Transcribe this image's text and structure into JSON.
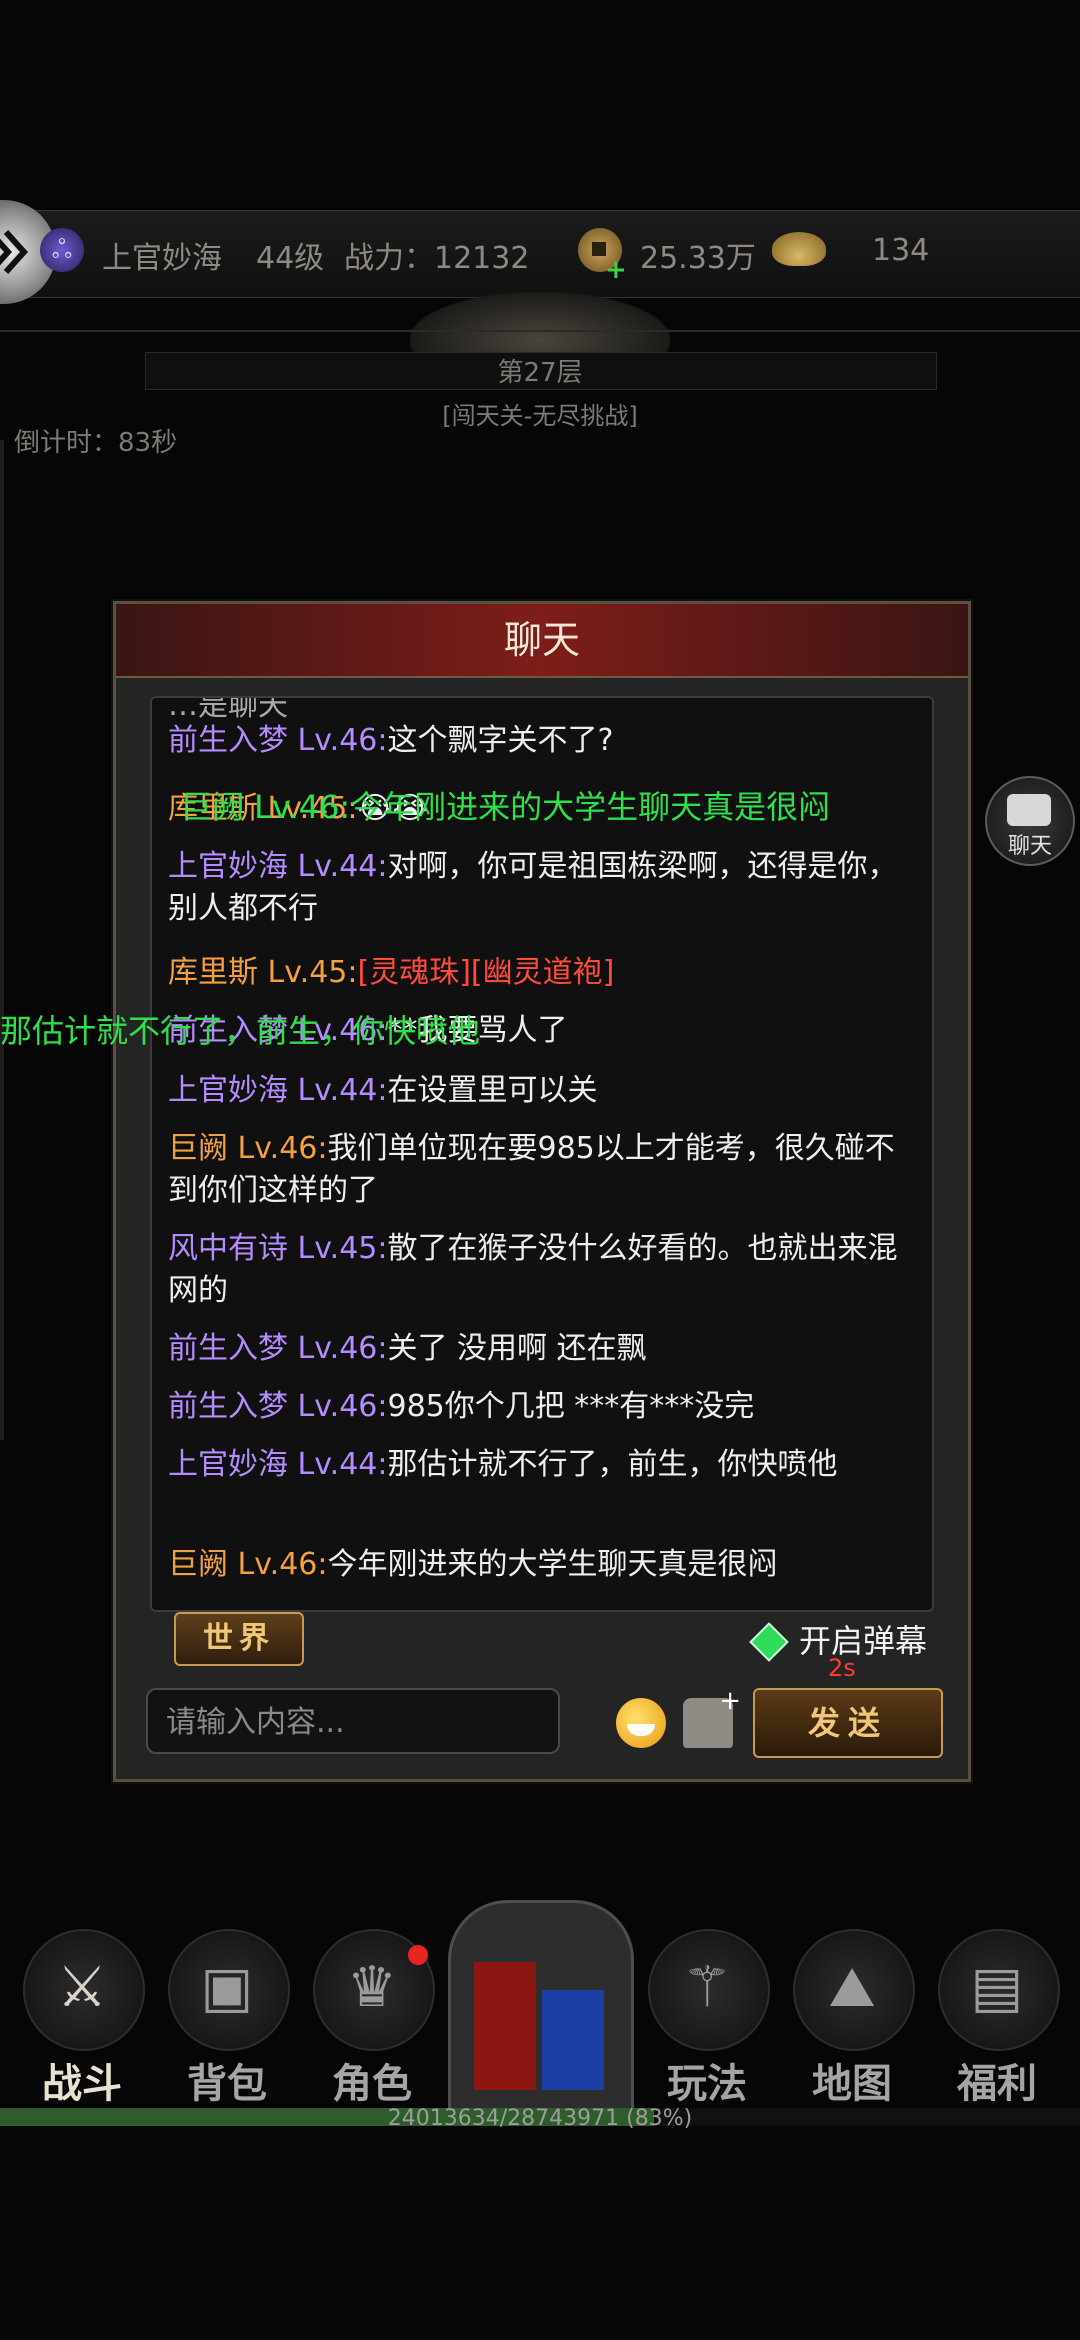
{
  "header": {
    "player_name": "上官妙海",
    "level": "44级",
    "power": "战力：12132",
    "coins": "25.33万",
    "gold": "134"
  },
  "stage": {
    "floor": "第27层",
    "subtitle": "[闯天关-无尽挑战]",
    "countdown": "倒计时：83秒"
  },
  "chat_button_label": "聊天",
  "dialog": {
    "title": "聊天",
    "cut_line": "…是聊天",
    "messages": [
      {
        "name": "前生入梦 Lv.46:",
        "text": "这个飘字关不了?",
        "name_color": "purple"
      },
      {
        "name": "库里斯 Lv.45:",
        "text": "😭😭",
        "name_color": "orange"
      },
      {
        "name": "上官妙海 Lv.44:",
        "text": "对啊，你可是祖国栋梁啊，还得是你，别人都不行",
        "name_color": "purple"
      },
      {
        "name": "库里斯 Lv.45:",
        "text": "[灵魂珠][幽灵道袍]",
        "name_color": "orange"
      },
      {
        "name": "前生入梦 Lv.46:",
        "text": "**我要骂人了",
        "name_color": "purple"
      },
      {
        "name": "上官妙海 Lv.44:",
        "text": "在设置里可以关",
        "name_color": "purple"
      },
      {
        "name": "巨阙 Lv.46:",
        "text": "我们单位现在要985以上才能考，很久碰不到你们这样的了",
        "name_color": "orange"
      },
      {
        "name": "风中有诗 Lv.45:",
        "text": "散了在猴子没什么好看的。也就出来混网的",
        "name_color": "purple"
      },
      {
        "name": "前生入梦 Lv.46:",
        "text": "关了 没用啊 还在飘",
        "name_color": "purple"
      },
      {
        "name": "前生入梦 Lv.46:",
        "text": "985你个几把 ***有***没完",
        "name_color": "purple"
      },
      {
        "name": "上官妙海 Lv.44:",
        "text": "那估计就不行了，前生，你快喷他",
        "name_color": "purple"
      },
      {
        "name": "巨阙 Lv.46:",
        "text": "今年刚进来的大学生聊天真是很闷",
        "name_color": "orange"
      }
    ],
    "tab_world": "世界",
    "barrage_label": "开启弹幕",
    "cooldown": "2s",
    "input_placeholder": "请输入内容...",
    "send_label": "发送"
  },
  "danmaku": [
    "巨阙 Lv.46:今年刚进来的大学生聊天真是很闷",
    "那估计就不行了，前生，你快喷他"
  ],
  "nav": {
    "items": [
      {
        "label": "战斗",
        "icon": "crossed-swords-icon"
      },
      {
        "label": "背包",
        "icon": "backpack-icon"
      },
      {
        "label": "角色",
        "icon": "helmet-icon"
      },
      {
        "label": "玩法",
        "icon": "sword-slash-icon"
      },
      {
        "label": "地图",
        "icon": "map-icon"
      },
      {
        "label": "福利",
        "icon": "treasure-chest-icon"
      }
    ]
  },
  "hp": {
    "text": "24013634/28743971 (83%)",
    "fraction": 0.83
  },
  "colors": {
    "purple_name": "#b48cff",
    "orange_name": "#f5a040",
    "item_red": "#ff4a3c",
    "danmaku_green": "#2ee04a"
  }
}
